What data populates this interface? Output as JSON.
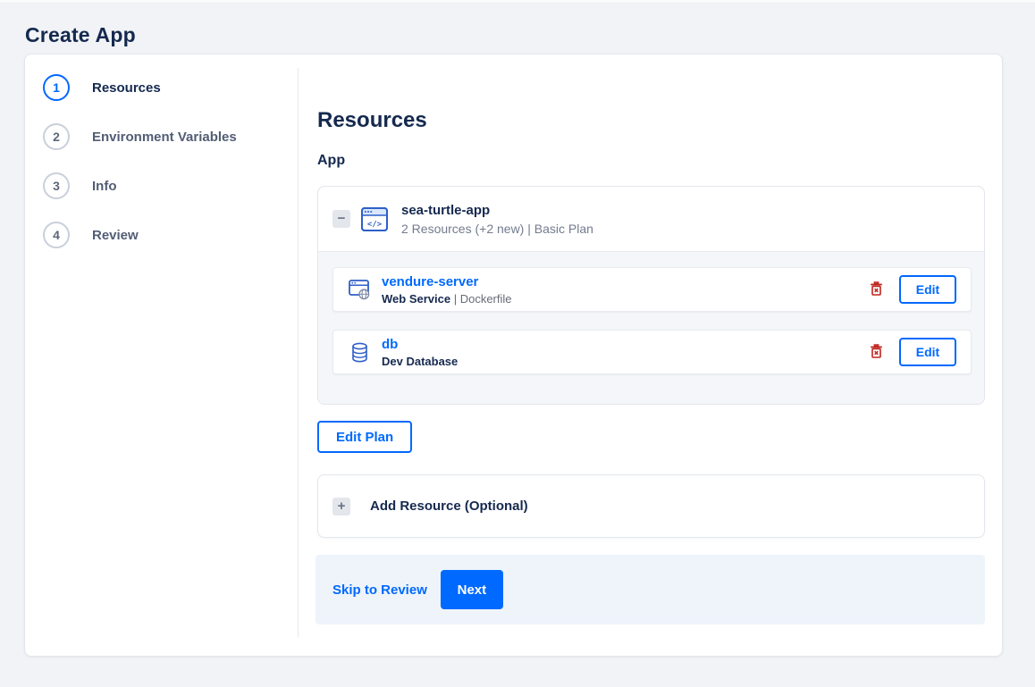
{
  "page": {
    "title": "Create App"
  },
  "wizard": {
    "active_step": "1",
    "steps": [
      {
        "number": "1",
        "label": "Resources"
      },
      {
        "number": "2",
        "label": "Environment Variables"
      },
      {
        "number": "3",
        "label": "Info"
      },
      {
        "number": "4",
        "label": "Review"
      }
    ]
  },
  "main": {
    "heading": "Resources",
    "section_label": "App",
    "app_group": {
      "name": "sea-turtle-app",
      "summary": "2 Resources (+2 new) | Basic Plan",
      "collapse_glyph": "−"
    },
    "resources": [
      {
        "name": "vendure-server",
        "type": "Web Service",
        "detail": " | Dockerfile",
        "edit_label": "Edit"
      },
      {
        "name": "db",
        "type": "Dev Database",
        "detail": "",
        "edit_label": "Edit"
      }
    ],
    "edit_plan_label": "Edit Plan",
    "add_resource": {
      "label": "Add Resource (Optional)",
      "plus_glyph": "+"
    }
  },
  "footer": {
    "skip_label": "Skip to Review",
    "next_label": "Next"
  },
  "icons": {
    "app": "app-window-code-icon",
    "web_service": "browser-globe-icon",
    "database": "database-cylinder-icon",
    "delete": "trash-icon"
  },
  "colors": {
    "accent_blue": "#0069ff",
    "heading_navy": "#15294f",
    "muted_gray": "#676b79",
    "danger_red": "#c0251f",
    "page_bg": "#f1f3f6",
    "footer_bg": "#eef4fa"
  }
}
